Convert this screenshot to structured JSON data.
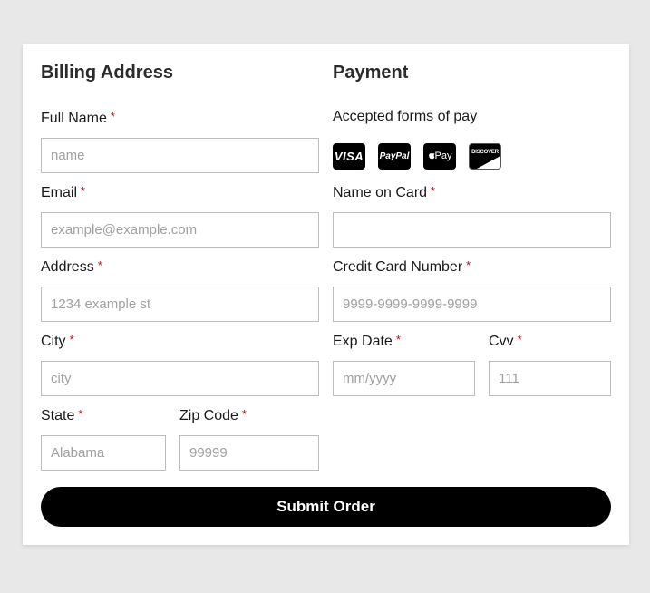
{
  "billing": {
    "title": "Billing Address",
    "full_name": {
      "label": "Full Name",
      "required": "*",
      "placeholder": "name",
      "value": ""
    },
    "email": {
      "label": "Email",
      "required": "*",
      "placeholder": "example@example.com",
      "value": ""
    },
    "address": {
      "label": "Address",
      "required": "*",
      "placeholder": "1234 example st",
      "value": ""
    },
    "city": {
      "label": "City",
      "required": "*",
      "placeholder": "city",
      "value": ""
    },
    "state": {
      "label": "State",
      "required": "*",
      "placeholder": "Alabama",
      "value": ""
    },
    "zip": {
      "label": "Zip Code",
      "required": "*",
      "placeholder": "99999",
      "value": ""
    }
  },
  "payment": {
    "title": "Payment",
    "accepted_label": "Accepted forms of pay",
    "cards": [
      {
        "name": "visa-icon",
        "text": "VISA"
      },
      {
        "name": "paypal-icon",
        "text": "PayPal"
      },
      {
        "name": "apple-pay-icon",
        "text": "Pay"
      },
      {
        "name": "discover-icon",
        "text": "DISCOVER"
      }
    ],
    "name_on_card": {
      "label": "Name on Card",
      "required": "*",
      "placeholder": "",
      "value": ""
    },
    "card_number": {
      "label": "Credit Card Number",
      "required": "*",
      "placeholder": "9999-9999-9999-9999",
      "value": ""
    },
    "exp_date": {
      "label": "Exp Date",
      "required": "*",
      "placeholder": "mm/yyyy",
      "value": ""
    },
    "cvv": {
      "label": "Cvv",
      "required": "*",
      "placeholder": "111",
      "value": ""
    }
  },
  "submit_label": "Submit Order",
  "colors": {
    "background": "#e8e8e8",
    "card": "#ffffff",
    "required": "#d0021b",
    "button": "#000000"
  }
}
